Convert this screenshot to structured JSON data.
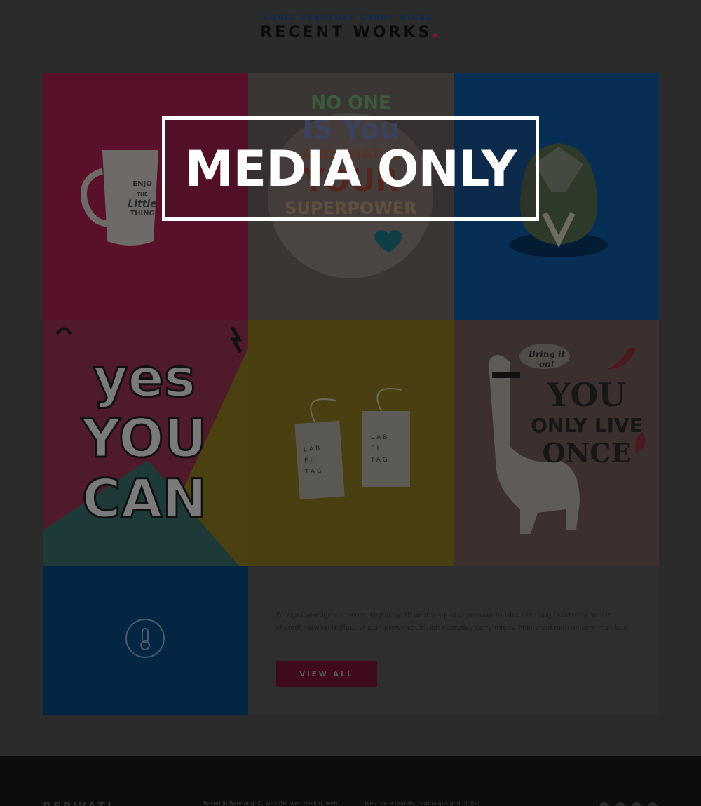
{
  "header": {
    "eyebrow": "SQUID EVERYDAY CARRY MIGAS.",
    "title": "RECENT WORKS",
    "title_dot": "."
  },
  "overlay": {
    "label": "MEDIA ONLY"
  },
  "tiles": {
    "mug": {
      "line1": "ENJO",
      "line2": "THE",
      "line3": "Little",
      "line4": "THING"
    },
    "superpower": {
      "l1": "NO ONE",
      "l2": "IS You",
      "l3": "AND THAT IS",
      "l4": "YOUR",
      "l5": "SUPERPOWER"
    },
    "helmet": {},
    "yes_you_can": {
      "l1": "yes",
      "l2": "YOU",
      "l3": "CAN"
    },
    "label_tag": {
      "tag1": "LAB EL TAG",
      "tag2": "LAB EL TAG"
    },
    "yolo": {
      "bubble": "Bring it on!",
      "l1": "YOU",
      "l2": "ONLY LIVE",
      "l3": "ONCE"
    }
  },
  "about": {
    "description": "Forage live-edge normcore, keytar synth neutra squid vaporware tousled cred pug taxidermy. Yuccie shoredi narwhal truffaut yr stumptown squid ugh everyday carry migas. Man braid meh unicorn man bun.",
    "button_label": "VIEW ALL"
  },
  "footer": {
    "logo": "PERWATI",
    "col1": "Based in Bandung ID, we offer web design, web",
    "col2": "We create brands, campaigns and digital"
  },
  "colors": {
    "accent": "#a0073a",
    "navy": "#0b2a56"
  }
}
